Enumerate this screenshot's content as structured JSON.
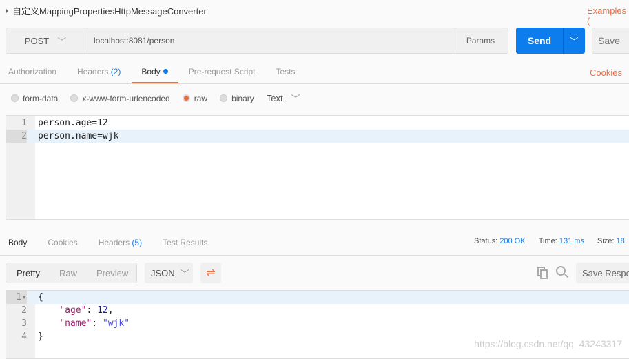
{
  "request": {
    "title": "自定义MappingPropertiesHttpMessageConverter",
    "examples_label": "Examples (",
    "method": "POST",
    "url": "localhost:8081/person",
    "params_label": "Params",
    "send_label": "Send",
    "save_label": "Save"
  },
  "request_tabs": [
    {
      "label": "Authorization"
    },
    {
      "label": "Headers",
      "count": "(2)"
    },
    {
      "label": "Body"
    },
    {
      "label": "Pre-request Script"
    },
    {
      "label": "Tests"
    }
  ],
  "cookies_label": "Cookies",
  "body_modes": [
    {
      "label": "form-data"
    },
    {
      "label": "x-www-form-urlencoded"
    },
    {
      "label": "raw",
      "selected": true
    },
    {
      "label": "binary"
    }
  ],
  "body_type": "Text",
  "request_body": [
    "person.age=12",
    "person.name=wjk"
  ],
  "response_tabs": [
    {
      "label": "Body"
    },
    {
      "label": "Cookies"
    },
    {
      "label": "Headers",
      "count": "(5)"
    },
    {
      "label": "Test Results"
    }
  ],
  "status": {
    "status_label": "Status:",
    "status_value": "200 OK",
    "time_label": "Time:",
    "time_value": "131 ms",
    "size_label": "Size:",
    "size_value": "18"
  },
  "view_modes": [
    "Pretty",
    "Raw",
    "Preview"
  ],
  "format": "JSON",
  "save_response_label": "Save Respon",
  "response_body": {
    "open": "{",
    "age_key": "\"age\"",
    "age_val": "12",
    "name_key": "\"name\"",
    "name_val": "\"wjk\"",
    "close": "}"
  },
  "watermark": "https://blog.csdn.net/qq_43243317",
  "colors": {
    "accent": "#f26b3a",
    "send": "#0d7ced"
  }
}
